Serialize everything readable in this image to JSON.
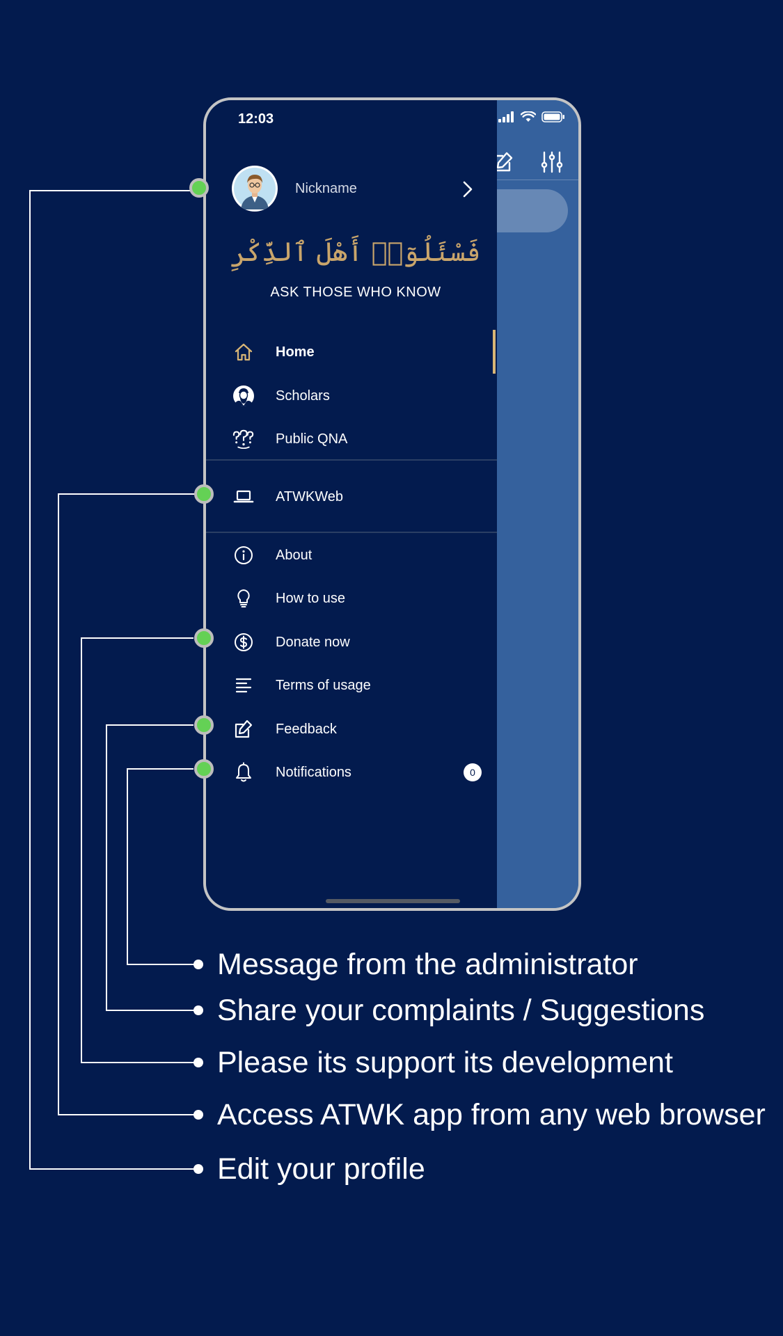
{
  "colors": {
    "background": "#031b4e",
    "drawer_background": "#031b4e",
    "app_background": "#35619d",
    "accent_gold": "#c9a56b",
    "callout_dot": "#64d155",
    "phone_frame": "#c4c4c4"
  },
  "status_bar": {
    "time": "12:03",
    "icons": [
      "signal-icon",
      "wifi-icon",
      "battery-icon"
    ]
  },
  "app_toolbar": {
    "icons": [
      "compose-icon",
      "filter-sliders-icon"
    ]
  },
  "drawer": {
    "profile": {
      "nickname": "Nickname",
      "avatar_icon": "user-avatar-icon",
      "action_icon": "chevron-right-icon"
    },
    "arabic_title": "فَسْئَلُوٓا۟ أَهْلَ ٱلذِّكْرِ",
    "tagline": "ASK THOSE WHO KNOW",
    "menu_primary": [
      {
        "label": "Home",
        "icon": "home-icon",
        "active": true
      },
      {
        "label": "Scholars",
        "icon": "scholar-icon"
      },
      {
        "label": "Public QNA",
        "icon": "questions-icon"
      }
    ],
    "menu_web": [
      {
        "label": "ATWKWeb",
        "icon": "laptop-icon"
      }
    ],
    "menu_secondary": [
      {
        "label": "About",
        "icon": "info-icon"
      },
      {
        "label": "How to use",
        "icon": "lightbulb-icon"
      },
      {
        "label": "Donate now",
        "icon": "dollar-icon"
      },
      {
        "label": "Terms of usage",
        "icon": "align-left-icon"
      },
      {
        "label": "Feedback",
        "icon": "edit-icon"
      },
      {
        "label": "Notifications",
        "icon": "bell-icon",
        "badge": "0"
      }
    ]
  },
  "callouts": [
    {
      "text": "Message from the administrator",
      "target": "Notifications"
    },
    {
      "text": "Share your complaints / Suggestions",
      "target": "Feedback"
    },
    {
      "text": "Please its support its development",
      "target": "Donate now"
    },
    {
      "text": "Access ATWK app from any web browser",
      "target": "ATWKWeb"
    },
    {
      "text": "Edit your profile",
      "target": "Profile"
    }
  ]
}
